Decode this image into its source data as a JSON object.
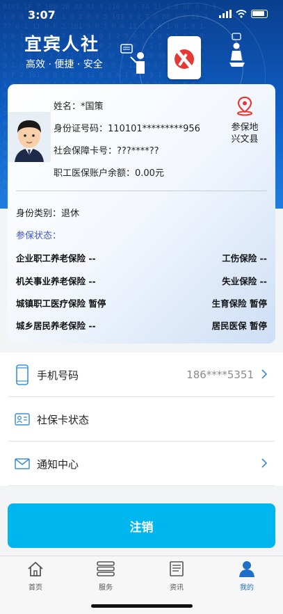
{
  "status_bar": {
    "time": "3:07"
  },
  "header": {
    "title": "宜宾人社",
    "slogan": "高效 · 便捷 · 安全"
  },
  "profile": {
    "name_line": "姓名：*国策",
    "id_line": "身份证号码：110101*********956",
    "card_line": "社会保障卡号：???****??",
    "balance_line": "职工医保账户余额：0.00元",
    "location_title": "参保地",
    "location_value": "兴文县",
    "identity_line": "身份类别：退休",
    "status_title": "参保状态："
  },
  "insurance": [
    {
      "left": "企业职工养老保险 --",
      "right": "工伤保险 --"
    },
    {
      "left": "机关事业养老保险 --",
      "right": "失业保险 --"
    },
    {
      "left": "城镇职工医疗保险  暂停",
      "right": "生育保险 暂停"
    },
    {
      "left": "城乡居民养老保险 --",
      "right": "居民医保 暂停"
    }
  ],
  "menu": {
    "phone_label": "手机号码",
    "phone_value": "186****5351",
    "card_status_label": "社保卡状态",
    "notice_label": "通知中心"
  },
  "logout_label": "注销",
  "tabs": [
    {
      "label": "首页",
      "icon": "home-icon"
    },
    {
      "label": "服务",
      "icon": "stack-icon"
    },
    {
      "label": "资讯",
      "icon": "news-icon"
    },
    {
      "label": "我的",
      "icon": "user-icon"
    }
  ],
  "colors": {
    "primary": "#00b6ee",
    "banner": "#0f5fc6",
    "active_tab": "#1f6fc8",
    "accent_red": "#e53935"
  }
}
